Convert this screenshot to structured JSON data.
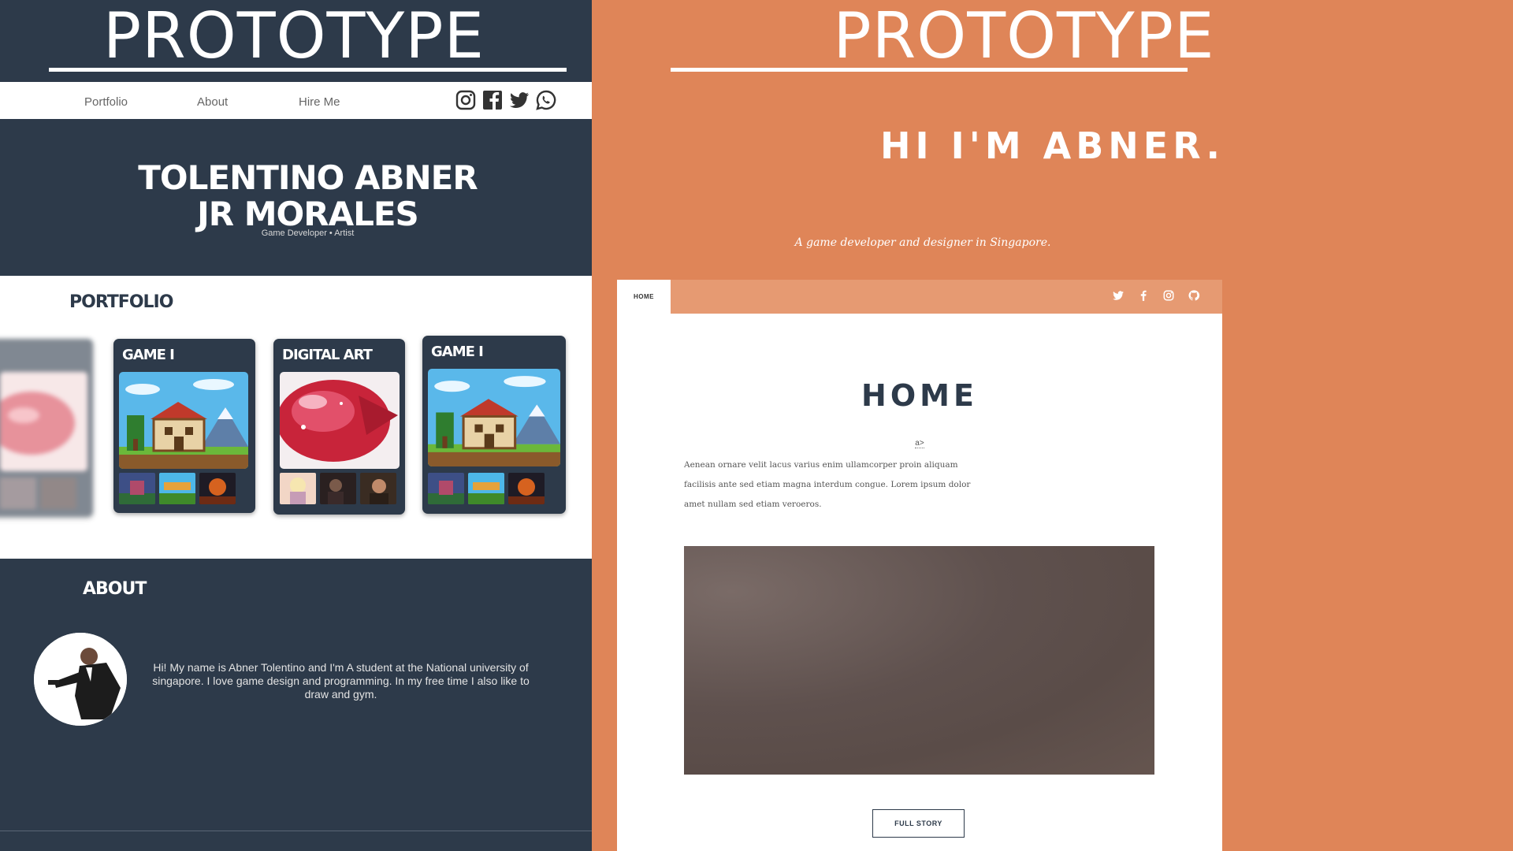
{
  "left": {
    "banner_title": "PROTOTYPE",
    "nav": {
      "links": [
        "Portfolio",
        "About",
        "Hire Me"
      ],
      "social": [
        "instagram-icon",
        "facebook-icon",
        "twitter-icon",
        "whatsapp-icon"
      ]
    },
    "hero": {
      "name_line1": "TOLENTINO ABNER",
      "name_line2": "JR MORALES",
      "subtitle": "Game Developer • Artist"
    },
    "portfolio": {
      "title": "PORTFOLIO",
      "cards": [
        {
          "title": "GAME I"
        },
        {
          "title": "DIGITAL ART"
        },
        {
          "title": "GAME I"
        }
      ]
    },
    "about": {
      "title": "ABOUT",
      "text": "Hi! My name is Abner Tolentino and I'm A student at the National university of singapore. I love game design and programming. In my free time I also like to draw and gym."
    }
  },
  "right": {
    "banner_title": "PROTOTYPE",
    "headline": "HI I'M ABNER.",
    "tagline": "A game developer and designer in Singapore.",
    "site": {
      "tab_label": "HOME",
      "social": [
        "twitter-icon",
        "facebook-icon",
        "instagram-icon",
        "github-icon"
      ],
      "heading": "HOME",
      "link_text": "a>",
      "paragraph": "Aenean ornare velit lacus varius enim ullamcorper proin aliquam facilisis ante sed etiam magna interdum congue. Lorem ipsum dolor amet nullam sed etiam veroeros.",
      "button_label": "FULL STORY"
    }
  },
  "colors": {
    "navy": "#2d3a4a",
    "orange": "#df8558",
    "light_orange": "#e69a72",
    "white": "#ffffff"
  }
}
